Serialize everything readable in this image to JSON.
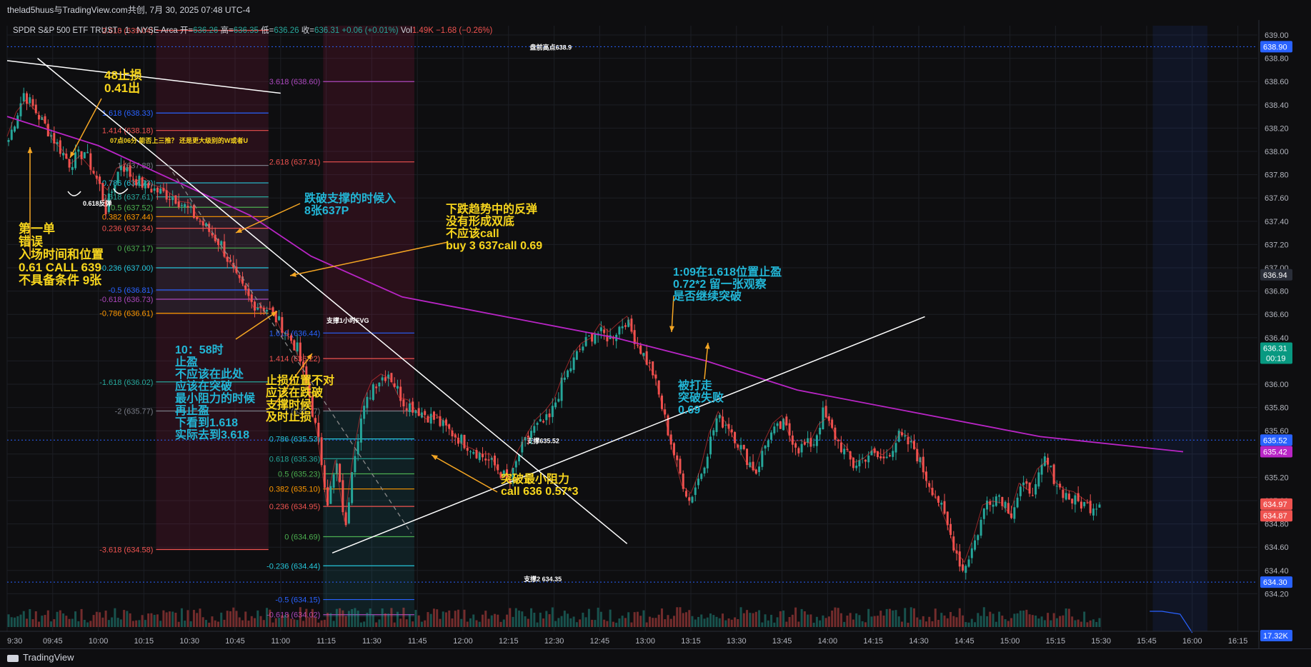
{
  "header": {
    "watermark": "thelad5huus与TradingView.com共创, 7月 30, 2025 07:48 UTC-4"
  },
  "legend": {
    "symbol": "SPDR S&P 500 ETF TRUST · 1 · NYSE Arca",
    "open_label": "开=",
    "open": "636.26",
    "high_label": "高=",
    "high": "636.35",
    "low_label": "低=",
    "low": "636.26",
    "close_label": "收=",
    "close": "636.31",
    "change": "+0.06 (+0.01%)",
    "vol_label": "Vol",
    "vol": "1.49K",
    "vol_change": "−1.68 (−0.26%)"
  },
  "footer": {
    "brand": "TradingView"
  },
  "colors": {
    "bg": "#0e0e10",
    "up": "#26a69a",
    "down": "#ef5350",
    "ma": "#b925c6",
    "annot_yellow": "#f7d51d",
    "annot_cyan": "#22b6d6",
    "arrow_orange": "#f5a623"
  },
  "chart_data": {
    "type": "candlestick",
    "ylim": [
      634.0,
      639.08
    ],
    "y_ticks": [
      "639.00",
      "638.80",
      "638.60",
      "638.40",
      "638.20",
      "638.00",
      "637.80",
      "637.60",
      "637.40",
      "637.20",
      "637.00",
      "636.80",
      "636.60",
      "636.40",
      "636.20",
      "636.00",
      "635.80",
      "635.60",
      "635.40",
      "635.20",
      "635.00",
      "634.80",
      "634.60",
      "634.40",
      "634.20"
    ],
    "x_ticks": [
      "9:30",
      "09:45",
      "10:00",
      "10:15",
      "10:30",
      "10:45",
      "11:00",
      "11:15",
      "11:30",
      "11:45",
      "12:00",
      "12:15",
      "12:30",
      "12:45",
      "13:00",
      "13:15",
      "13:30",
      "13:45",
      "14:00",
      "14:15",
      "14:30",
      "14:45",
      "15:00",
      "15:15",
      "15:30",
      "15:45",
      "16:00",
      "16:15"
    ],
    "price_badges": [
      {
        "value": "638.90",
        "color": "#2962ff"
      },
      {
        "value": "636.94",
        "color": "#2a2e39"
      },
      {
        "value": "636.31",
        "color": "#089981",
        "sub": "00:19"
      },
      {
        "value": "635.52",
        "color": "#2962ff"
      },
      {
        "value": "635.42",
        "color": "#b925c6"
      },
      {
        "value": "634.97",
        "color": "#ef5350"
      },
      {
        "value": "634.87",
        "color": "#ef5350"
      },
      {
        "value": "634.30",
        "color": "#2962ff"
      },
      {
        "value": "17.32K",
        "color": "#2962ff"
      }
    ],
    "key_levels": [
      {
        "label": "盘前高点638.9",
        "value": 638.9
      },
      {
        "label": "支撑635.52",
        "value": 635.52
      },
      {
        "label": "支撑2 634.35",
        "value": 634.3
      }
    ],
    "fib1": [
      {
        "label": "2.618 (639.04)",
        "value": 639.04,
        "color": "#ef5350"
      },
      {
        "label": "1.618 (638.33)",
        "value": 638.33,
        "color": "#2962ff"
      },
      {
        "label": "1.414 (638.18)",
        "value": 638.18,
        "color": "#ef5350"
      },
      {
        "label": "1 (637.88)",
        "value": 637.88,
        "color": "#787b86"
      },
      {
        "label": "0.786 (637.73)",
        "value": 637.73,
        "color": "#26c6da"
      },
      {
        "label": "0.618 (637.61)",
        "value": 637.61,
        "color": "#26a69a"
      },
      {
        "label": "0.5 (637.52)",
        "value": 637.52,
        "color": "#4caf50"
      },
      {
        "label": "0.382 (637.44)",
        "value": 637.44,
        "color": "#ff9800"
      },
      {
        "label": "0.236 (637.34)",
        "value": 637.34,
        "color": "#ef5350"
      },
      {
        "label": "0 (637.17)",
        "value": 637.17,
        "color": "#4caf50"
      },
      {
        "label": "-0.236 (637.00)",
        "value": 637.0,
        "color": "#26c6da"
      },
      {
        "label": "-0.5 (636.81)",
        "value": 636.81,
        "color": "#2962ff"
      },
      {
        "label": "-0.618 (636.73)",
        "value": 636.73,
        "color": "#ab47bc"
      },
      {
        "label": "-0.786 (636.61)",
        "value": 636.61,
        "color": "#ff9800"
      },
      {
        "label": "-1.618 (636.02)",
        "value": 636.02,
        "color": "#26a69a"
      },
      {
        "label": "-2 (635.77)",
        "value": 635.77,
        "color": "#787b86"
      },
      {
        "label": "-3.618 (634.58)",
        "value": 634.58,
        "color": "#ef5350"
      }
    ],
    "fib2": [
      {
        "label": "3.618 (638.60)",
        "value": 638.6,
        "color": "#ab47bc"
      },
      {
        "label": "2.618 (637.91)",
        "value": 637.91,
        "color": "#ef5350"
      },
      {
        "label": "1.618 (636.44)",
        "value": 636.44,
        "color": "#2962ff"
      },
      {
        "label": "1.414 (636.22)",
        "value": 636.22,
        "color": "#ef5350"
      },
      {
        "label": "1 (635.77)",
        "value": 635.77,
        "color": "#787b86"
      },
      {
        "label": "0.786 (635.53)",
        "value": 635.53,
        "color": "#26c6da"
      },
      {
        "label": "0.618 (635.36)",
        "value": 635.36,
        "color": "#26a69a"
      },
      {
        "label": "0.5 (635.23)",
        "value": 635.23,
        "color": "#4caf50"
      },
      {
        "label": "0.382 (635.10)",
        "value": 635.1,
        "color": "#ff9800"
      },
      {
        "label": "0.236 (634.95)",
        "value": 634.95,
        "color": "#ef5350"
      },
      {
        "label": "0 (634.69)",
        "value": 634.69,
        "color": "#4caf50"
      },
      {
        "label": "-0.236 (634.44)",
        "value": 634.44,
        "color": "#26c6da"
      },
      {
        "label": "-0.5 (634.15)",
        "value": 634.15,
        "color": "#2962ff"
      },
      {
        "label": "-0.618 (634.02)",
        "value": 634.02,
        "color": "#ab47bc"
      }
    ],
    "ohlc_path": [
      [
        0,
        638.1
      ],
      [
        5,
        638.5
      ],
      [
        10,
        638.3
      ],
      [
        20,
        637.9
      ],
      [
        25,
        638.0
      ],
      [
        30,
        637.7
      ],
      [
        32,
        637.5
      ],
      [
        37,
        637.9
      ],
      [
        40,
        637.8
      ],
      [
        45,
        637.7
      ],
      [
        55,
        637.6
      ],
      [
        63,
        637.4
      ],
      [
        70,
        637.2
      ],
      [
        75,
        636.9
      ],
      [
        80,
        636.7
      ],
      [
        85,
        636.65
      ],
      [
        90,
        636.5
      ],
      [
        95,
        636.3
      ],
      [
        99,
        635.9
      ],
      [
        102,
        635.5
      ],
      [
        105,
        635.0
      ],
      [
        108,
        635.3
      ],
      [
        111,
        634.75
      ],
      [
        113,
        635.3
      ],
      [
        116,
        635.7
      ],
      [
        120,
        636.0
      ],
      [
        125,
        636.1
      ],
      [
        130,
        635.85
      ],
      [
        140,
        635.7
      ],
      [
        150,
        635.5
      ],
      [
        160,
        635.3
      ],
      [
        165,
        635.15
      ],
      [
        168,
        635.4
      ],
      [
        172,
        635.6
      ],
      [
        178,
        635.7
      ],
      [
        182,
        636.0
      ],
      [
        188,
        636.3
      ],
      [
        193,
        636.45
      ],
      [
        198,
        636.4
      ],
      [
        203,
        636.55
      ],
      [
        208,
        636.3
      ],
      [
        212,
        636.1
      ],
      [
        216,
        635.7
      ],
      [
        220,
        635.3
      ],
      [
        224,
        635.0
      ],
      [
        228,
        635.25
      ],
      [
        233,
        635.7
      ],
      [
        237,
        635.65
      ],
      [
        242,
        635.4
      ],
      [
        246,
        635.25
      ],
      [
        250,
        635.55
      ],
      [
        255,
        635.65
      ],
      [
        260,
        635.45
      ],
      [
        265,
        635.5
      ],
      [
        268,
        635.75
      ],
      [
        273,
        635.5
      ],
      [
        278,
        635.3
      ],
      [
        283,
        635.4
      ],
      [
        288,
        635.35
      ],
      [
        293,
        635.55
      ],
      [
        298,
        635.45
      ],
      [
        302,
        635.2
      ],
      [
        306,
        635.0
      ],
      [
        310,
        634.7
      ],
      [
        314,
        634.4
      ],
      [
        318,
        634.65
      ],
      [
        322,
        635.0
      ],
      [
        326,
        635.05
      ],
      [
        330,
        634.9
      ],
      [
        333,
        635.1
      ],
      [
        338,
        635.1
      ],
      [
        341,
        635.35
      ],
      [
        346,
        635.1
      ],
      [
        350,
        635.0
      ],
      [
        356,
        634.95
      ],
      [
        360,
        635.0
      ]
    ],
    "annotations": [
      {
        "text": "48止损\n0.41出",
        "color": "#f7d51d"
      },
      {
        "text": "第一单\n错误\n入场时间和位置\n0.61 CALL 639\n不具备条件 9张",
        "color": "#f7d51d"
      },
      {
        "text": "10：58时\n止盈\n不应该在此处\n应该在突破\n最小阻力的时候\n再止盈\n下看到1.618\n实际去到3.618",
        "color": "#22b6d6"
      },
      {
        "text": "止损位置不对\n应该在跌破\n支撑时候\n及时止损",
        "color": "#f7d51d"
      },
      {
        "text": "跌破支撑的时候入\n8张637P",
        "color": "#22b6d6"
      },
      {
        "text": "下跌趋势中的反弹\n没有形成双底\n不应该call\nbuy 3 637call 0.69",
        "color": "#f7d51d"
      },
      {
        "text": "突破最小阻力\ncall 636 0.57*3",
        "color": "#f7d51d"
      },
      {
        "text": "1:09在1.618位置止盈\n0.72*2 留一张观察\n是否继续突破",
        "color": "#22b6d6"
      },
      {
        "text": "被打走\n突破失败\n0.69",
        "color": "#22b6d6"
      },
      {
        "text": "07点06分 能否上三推？ 还是更大级别的W或者U",
        "color": "#f7d51d"
      },
      {
        "text": "0.618反弹",
        "color": "#ffffff"
      },
      {
        "text": "支撑1小时FVG",
        "color": "#ffffff"
      }
    ]
  }
}
